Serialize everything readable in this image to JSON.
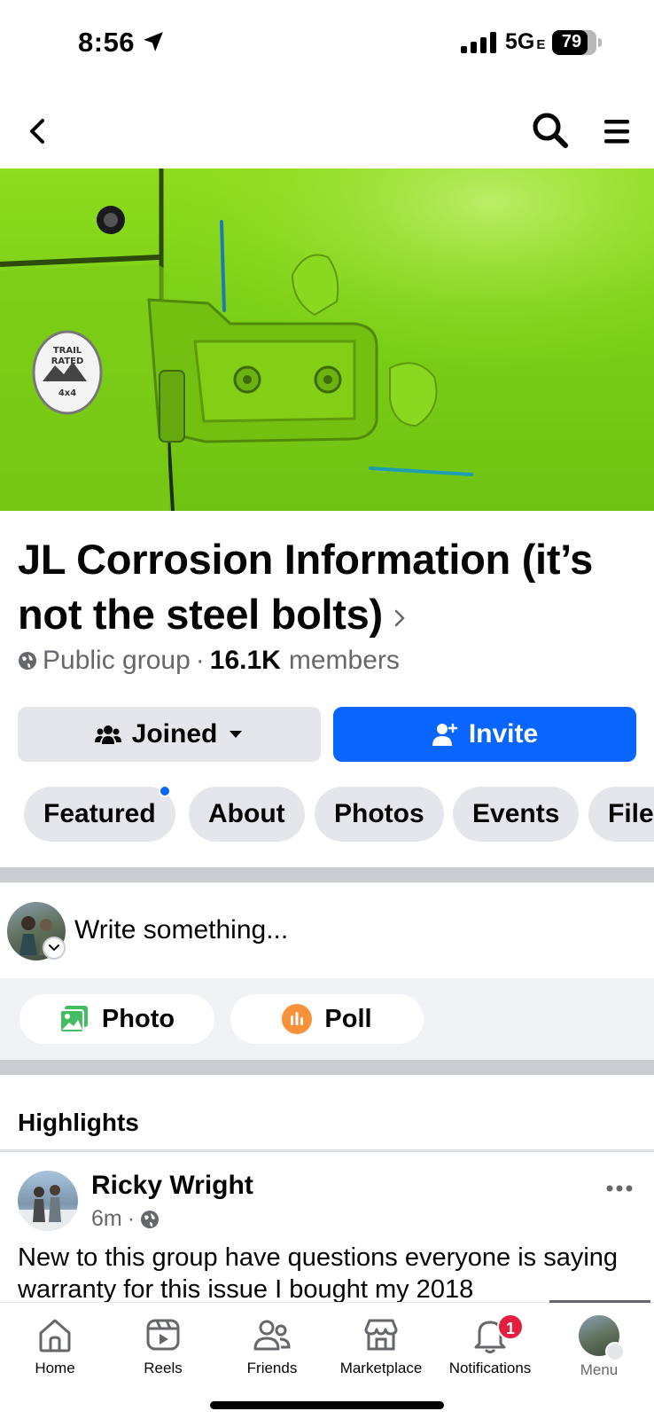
{
  "status_bar": {
    "time": "8:56",
    "network": "5G",
    "network_suffix": "E",
    "battery": "79",
    "battery_level": 0.79
  },
  "header": {
    "back_icon": "chevron-left-icon",
    "search_icon": "search-icon",
    "menu_icon": "hamburger-icon"
  },
  "group": {
    "title": "JL Corrosion Information (it’s not the steel bolts)",
    "privacy": "Public group",
    "separator": "·",
    "member_count": "16.1K",
    "members_label": "members",
    "badge_top": "TRAIL",
    "badge_mid": "RATED",
    "badge_bottom": "4x4"
  },
  "actions": {
    "joined_label": "Joined",
    "invite_label": "Invite"
  },
  "tabs": [
    {
      "label": "Featured",
      "has_dot": true
    },
    {
      "label": "About"
    },
    {
      "label": "Photos"
    },
    {
      "label": "Events"
    },
    {
      "label": "Files"
    }
  ],
  "composer": {
    "placeholder": "Write something...",
    "photo_label": "Photo",
    "poll_label": "Poll"
  },
  "highlights": {
    "title": "Highlights",
    "post": {
      "author": "Ricky Wright",
      "time": "6m",
      "dot": "·",
      "text": "New to this group have questions everyone is saying warranty for this issue I bought my 2018"
    }
  },
  "bottom_nav": [
    {
      "label": "Home",
      "icon": "home-icon"
    },
    {
      "label": "Reels",
      "icon": "reels-icon"
    },
    {
      "label": "Friends",
      "icon": "friends-icon"
    },
    {
      "label": "Marketplace",
      "icon": "marketplace-icon"
    },
    {
      "label": "Notifications",
      "icon": "bell-icon",
      "badge": "1"
    },
    {
      "label": "Menu",
      "icon": "profile-avatar"
    }
  ],
  "colors": {
    "accent": "#0866ff",
    "badge": "#e41e3f",
    "cover": "#7cd017",
    "secondary_text": "#65676b"
  }
}
